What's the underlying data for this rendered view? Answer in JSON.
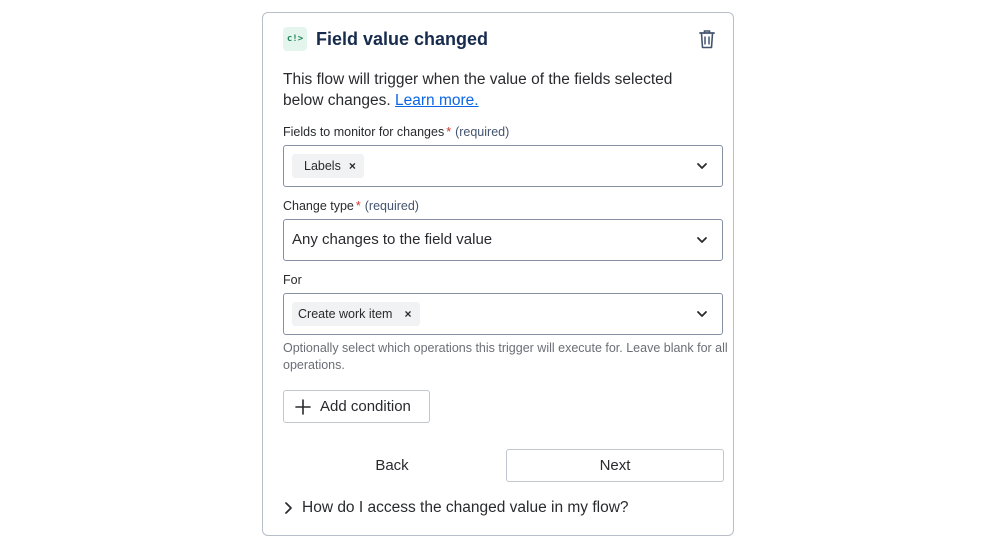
{
  "header": {
    "icon_text": "c!>",
    "title": "Field value changed"
  },
  "description": {
    "text": "This flow will trigger when the value of the fields selected below changes. ",
    "link": "Learn more."
  },
  "fields_to_monitor": {
    "label": "Fields to monitor for changes",
    "required_mark": "*",
    "hint": "(required)",
    "tags": [
      "Labels"
    ]
  },
  "change_type": {
    "label": "Change type",
    "required_mark": "*",
    "hint": "(required)",
    "value": "Any changes to the field value"
  },
  "for_field": {
    "label": "For",
    "tags": [
      "Create work item"
    ],
    "helper": "Optionally select which operations this trigger will execute for. Leave blank for all operations."
  },
  "add_condition": {
    "label": "Add condition"
  },
  "footer": {
    "back_label": "Back",
    "next_label": "Next"
  },
  "faq": {
    "label": "How do I access the changed value in my flow?"
  },
  "tag_remove_glyph": "×",
  "colors": {
    "link": "#0c66e4",
    "required": "#c9372c",
    "icon_green": "#1f845a"
  }
}
